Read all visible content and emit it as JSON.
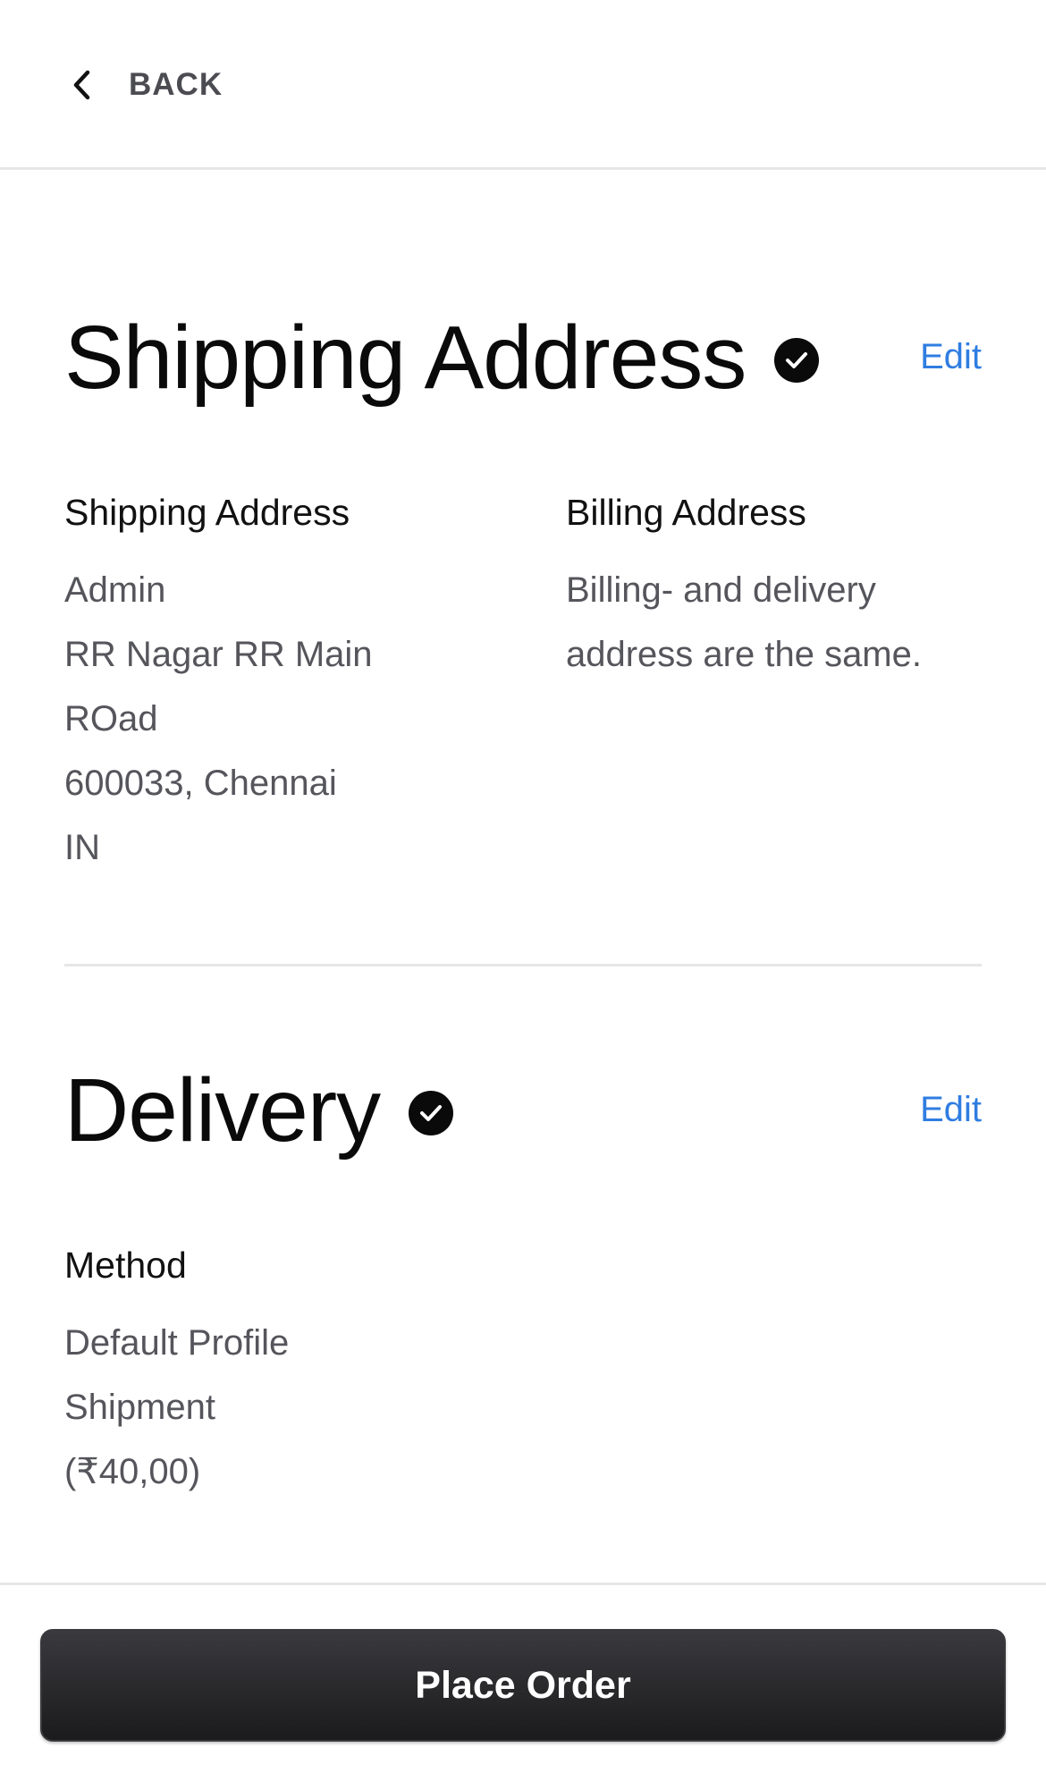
{
  "header": {
    "back_label": "BACK",
    "back_icon": "chevron-left-icon"
  },
  "shipping": {
    "title": "Shipping Address",
    "status_icon": "check-circle-icon",
    "edit_label": "Edit",
    "shipping_heading": "Shipping Address",
    "shipping_lines": [
      "Admin",
      "RR Nagar RR Main",
      "ROad",
      "600033, Chennai",
      "IN"
    ],
    "billing_heading": "Billing Address",
    "billing_lines": [
      "Billing- and delivery",
      "address are the same."
    ]
  },
  "delivery": {
    "title": "Delivery",
    "status_icon": "check-circle-icon",
    "edit_label": "Edit",
    "method_heading": "Method",
    "method_lines": [
      "Default Profile",
      "Shipment",
      "(₹40,00)"
    ]
  },
  "footer": {
    "place_order_label": "Place Order"
  },
  "colors": {
    "accent_link": "#2f7de1",
    "button_bg": "#1b1b1d",
    "divider": "#e6e6e8",
    "muted_text": "#55555c"
  }
}
